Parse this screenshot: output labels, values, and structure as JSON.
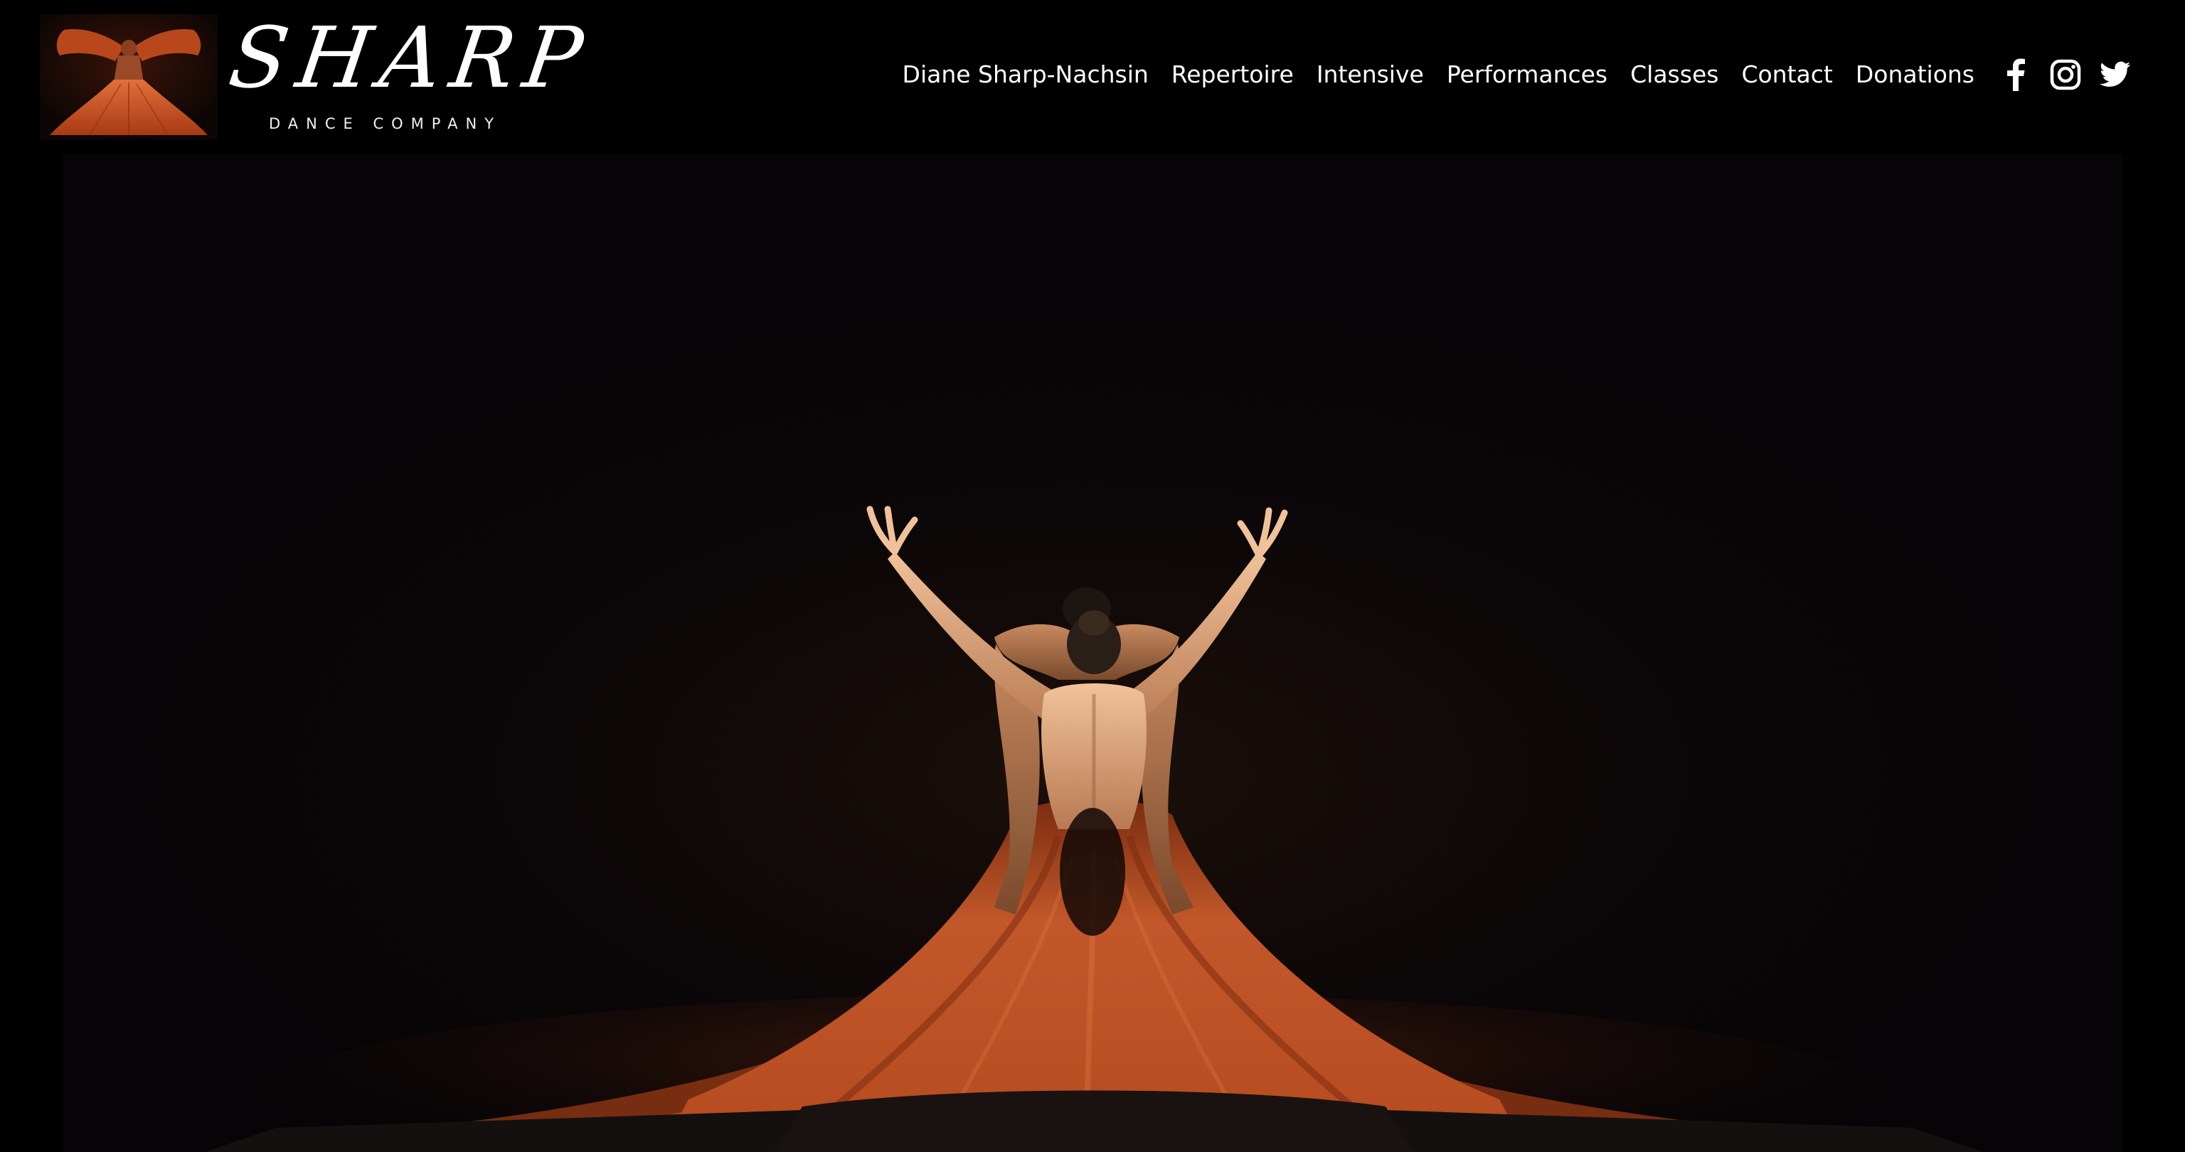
{
  "brand": {
    "name": "SHARP",
    "subtitle": "DANCE COMPANY"
  },
  "nav": {
    "items": [
      "Diane Sharp-Nachsin",
      "Repertoire",
      "Intensive",
      "Performances",
      "Classes",
      "Contact",
      "Donations"
    ]
  },
  "social": [
    "facebook-icon",
    "instagram-icon",
    "twitter-icon"
  ],
  "colors": {
    "background": "#000000",
    "nav_text": "#ffffff",
    "fabric": "#c2582a",
    "stage": "#070507"
  }
}
